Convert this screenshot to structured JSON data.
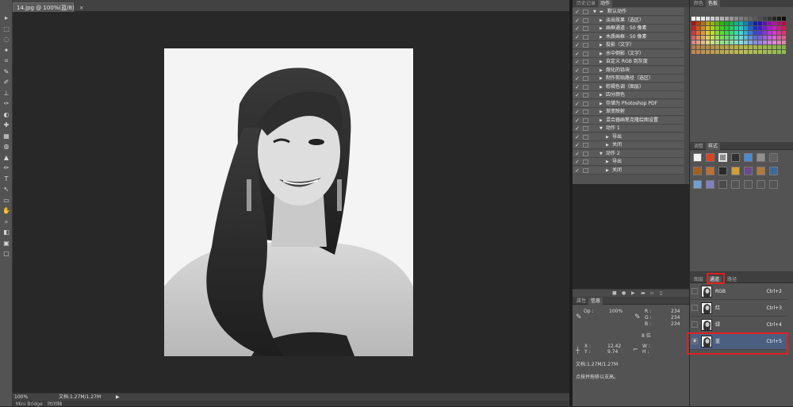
{
  "document_tab": {
    "title": "14.jpg @ 100%(蓝/8)",
    "close": "×"
  },
  "status": {
    "zoom": "100%",
    "doc": "文档:1.27M/1.27M"
  },
  "bottom_tabs": [
    "Mini Bridge",
    "时间轴"
  ],
  "actions_panel": {
    "tabs": [
      "历史记录",
      "动作"
    ],
    "active_tab": "动作",
    "items": [
      {
        "label": "默认动作",
        "level": 0,
        "folder": true,
        "expanded": true
      },
      {
        "label": "淡出效果（选区）",
        "level": 1
      },
      {
        "label": "画框通道 - 50 像素",
        "level": 1
      },
      {
        "label": "木质画框 - 50 像素",
        "level": 1
      },
      {
        "label": "投影（文字）",
        "level": 1
      },
      {
        "label": "水中倒影（文字）",
        "level": 1
      },
      {
        "label": "自定义 RGB 到灰度",
        "level": 1
      },
      {
        "label": "熔化的铅块",
        "level": 1
      },
      {
        "label": "制作剪贴路径（选区）",
        "level": 1
      },
      {
        "label": "棕褐色调（图层）",
        "level": 1
      },
      {
        "label": "四分颜色",
        "level": 1
      },
      {
        "label": "存储为 Photoshop PDF",
        "level": 1
      },
      {
        "label": "渐变映射",
        "level": 1
      },
      {
        "label": "混合器画笔克隆绘图设置",
        "level": 1
      },
      {
        "label": "动作 1",
        "level": 1,
        "expanded": true
      },
      {
        "label": "导出",
        "level": 2
      },
      {
        "label": "关闭",
        "level": 2
      },
      {
        "label": "动作 2",
        "level": 1,
        "expanded": true
      },
      {
        "label": "导出",
        "level": 2
      },
      {
        "label": "关闭",
        "level": 2
      }
    ]
  },
  "info_panel": {
    "tabs": [
      "属性",
      "信息"
    ],
    "active_tab": "信息",
    "op_label": "Op :",
    "op_value": "100%",
    "r_label": "R :",
    "r_value": "234",
    "g_label": "G :",
    "g_value": "234",
    "b_label": "B :",
    "b_value": "234",
    "bit": "8 位",
    "x_label": "X :",
    "x_value": "12.42",
    "y_label": "Y :",
    "y_value": "9.74",
    "w_label": "W :",
    "h_label": "H :",
    "doc": "文档:1.27M/1.27M",
    "hint": "点按并拖移以支高。"
  },
  "swatches_panel": {
    "tabs": [
      "颜色",
      "色板"
    ],
    "active_tab": "色板"
  },
  "styles_panel": {
    "tabs": [
      "调整",
      "样式"
    ],
    "active_tab": "样式"
  },
  "channels_panel": {
    "tabs": [
      "图层",
      "通道",
      "路径"
    ],
    "active_tab": "通道",
    "channels": [
      {
        "name": "RGB",
        "shortcut": "Ctrl+2",
        "selected": false
      },
      {
        "name": "红",
        "shortcut": "Ctrl+3",
        "selected": false
      },
      {
        "name": "绿",
        "shortcut": "Ctrl+4",
        "selected": false
      },
      {
        "name": "蓝",
        "shortcut": "Ctrl+5",
        "selected": true
      }
    ]
  },
  "colors": {
    "highlight_red": "#e02020",
    "selected_row": "#4b5f80",
    "panel_bg": "#535353",
    "canvas_bg": "#282828"
  }
}
